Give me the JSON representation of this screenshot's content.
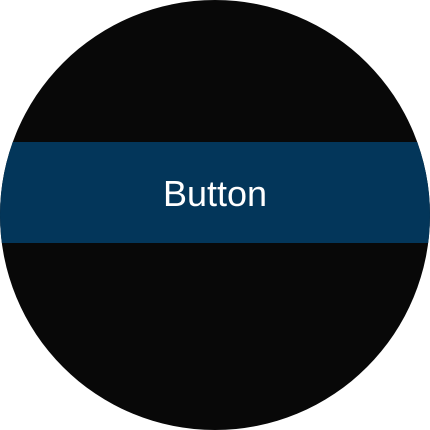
{
  "button": {
    "label": "Button"
  },
  "colors": {
    "background": "#080808",
    "button_fill": "#03365a",
    "button_text": "#ffffff"
  }
}
